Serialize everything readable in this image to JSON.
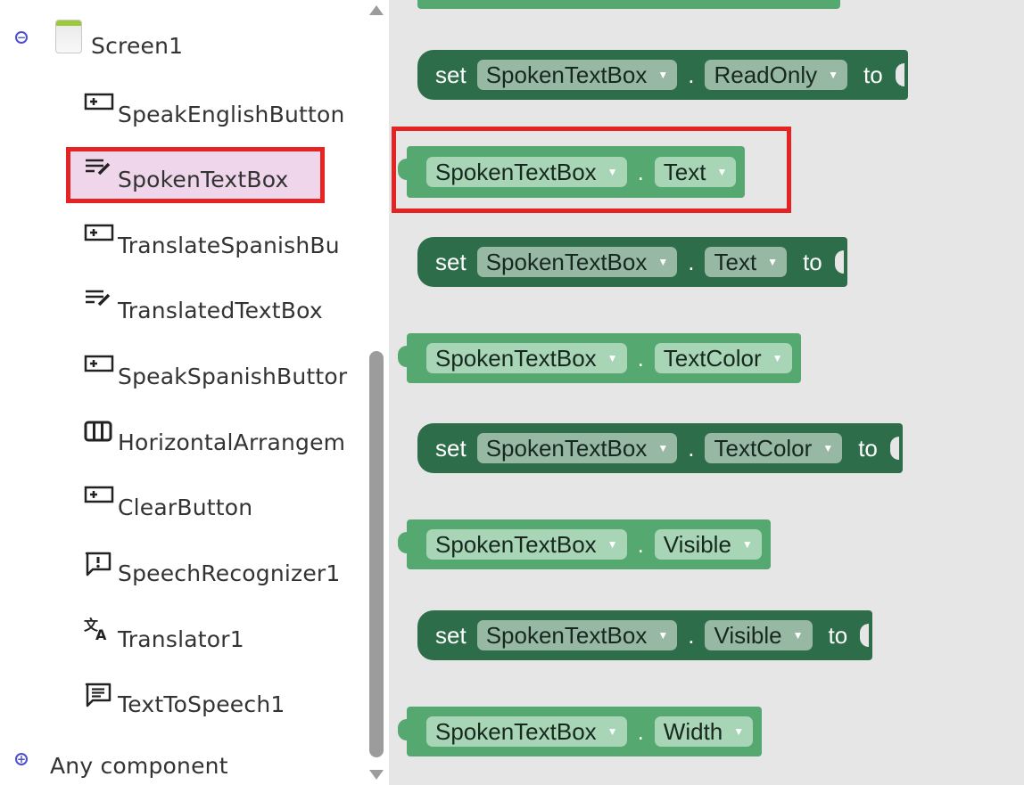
{
  "tree": {
    "screen": {
      "label": "Screen1",
      "toggle": "collapse"
    },
    "items": [
      {
        "label": "SpeakEnglishButton",
        "icon": "button-icon"
      },
      {
        "label": "SpokenTextBox",
        "icon": "textbox-icon",
        "selected": true
      },
      {
        "label": "TranslateSpanishBu",
        "icon": "button-icon"
      },
      {
        "label": "TranslatedTextBox",
        "icon": "textbox-icon"
      },
      {
        "label": "SpeakSpanishButtor",
        "icon": "button-icon"
      },
      {
        "label": "HorizontalArrangem",
        "icon": "horizontal-arrangement-icon"
      },
      {
        "label": "ClearButton",
        "icon": "button-icon"
      },
      {
        "label": "SpeechRecognizer1",
        "icon": "speech-recognizer-icon"
      },
      {
        "label": "Translator1",
        "icon": "translator-icon"
      },
      {
        "label": "TextToSpeech1",
        "icon": "text-to-speech-icon"
      }
    ],
    "any_component": {
      "label": "Any component",
      "toggle": "expand"
    }
  },
  "blocks": [
    {
      "kind": "set",
      "kw_set": "set",
      "component": "SpokenTextBox",
      "property": "ReadOnly",
      "kw_to": "to"
    },
    {
      "kind": "get",
      "component": "SpokenTextBox",
      "property": "Text",
      "highlighted": true
    },
    {
      "kind": "set",
      "kw_set": "set",
      "component": "SpokenTextBox",
      "property": "Text",
      "kw_to": "to"
    },
    {
      "kind": "get",
      "component": "SpokenTextBox",
      "property": "TextColor"
    },
    {
      "kind": "set",
      "kw_set": "set",
      "component": "SpokenTextBox",
      "property": "TextColor",
      "kw_to": "to"
    },
    {
      "kind": "get",
      "component": "SpokenTextBox",
      "property": "Visible"
    },
    {
      "kind": "set",
      "kw_set": "set",
      "component": "SpokenTextBox",
      "property": "Visible",
      "kw_to": "to"
    },
    {
      "kind": "get",
      "component": "SpokenTextBox",
      "property": "Width"
    }
  ],
  "dot": ".",
  "caret": "▼",
  "colors": {
    "set_block": "#2d6d4a",
    "get_block": "#55a86f",
    "highlight": "#e52323",
    "selected_bg": "#efd6ea",
    "toggle": "#4b4fd0"
  }
}
